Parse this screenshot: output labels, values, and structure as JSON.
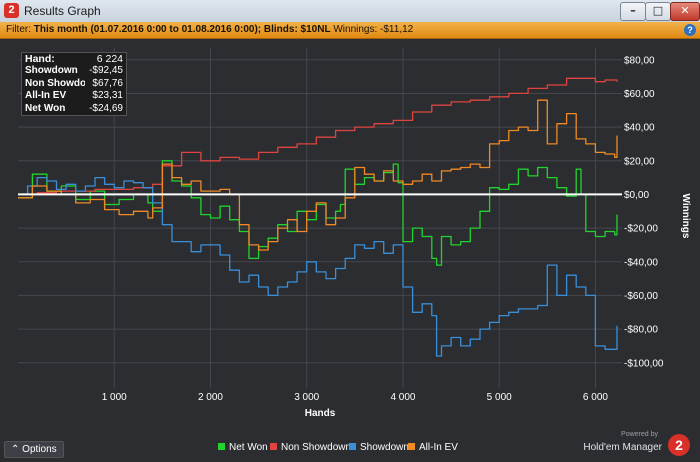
{
  "window": {
    "title": "Results Graph",
    "app_icon": "2",
    "minimize": "–",
    "maximize": "□",
    "close": "✕"
  },
  "filter": {
    "prefix": "Filter: ",
    "period_label": "This month (01.07.2016 0:00 to 01.08.2016 0:00)",
    "blinds_label": "; Blinds: $10NL",
    "winnings_label": " Winnings: -$11,12",
    "help": "?"
  },
  "stats": [
    {
      "label": "Hand:",
      "value": "6 224"
    },
    {
      "label": "Showdown",
      "value": "-$92,45"
    },
    {
      "label": "Non Showdown",
      "value": "$67,76"
    },
    {
      "label": "All-In EV",
      "value": "$23,31"
    },
    {
      "label": "Net Won",
      "value": "-$24,69"
    }
  ],
  "footer": {
    "options_label": "Options",
    "powered_by": "Powered by",
    "brand_name": "Hold'em Manager",
    "brand_logo": "2"
  },
  "colors": {
    "net_won": "#22d32e",
    "non_showdown": "#e0443e",
    "showdown": "#3a8fd9",
    "all_in_ev": "#f08a24"
  },
  "chart_data": {
    "type": "line",
    "xlabel": "Hands",
    "ylabel": "Winnings",
    "xlim": [
      0,
      6224
    ],
    "ylim": [
      -115,
      87
    ],
    "x_ticks": [
      1000,
      2000,
      3000,
      4000,
      5000,
      6000
    ],
    "x_tick_labels": [
      "1 000",
      "2 000",
      "3 000",
      "4 000",
      "5 000",
      "6 000"
    ],
    "y_ticks": [
      80,
      60,
      40,
      20,
      0,
      -20,
      -40,
      -60,
      -80,
      -100
    ],
    "y_tick_labels": [
      "$80,00",
      "$60,00",
      "$40,00",
      "$20,00",
      "$0,00",
      "-$20,00",
      "-$40,00",
      "-$60,00",
      "-$80,00",
      "-$100,00"
    ],
    "grid": true,
    "legend_position": "bottom",
    "series": [
      {
        "name": "Net Won",
        "color": "#22d32e",
        "x": [
          0,
          150,
          300,
          450,
          600,
          750,
          900,
          1050,
          1200,
          1350,
          1400,
          1500,
          1600,
          1700,
          1800,
          1900,
          2000,
          2100,
          2200,
          2300,
          2400,
          2500,
          2600,
          2700,
          2800,
          2900,
          3000,
          3100,
          3200,
          3300,
          3350,
          3400,
          3500,
          3600,
          3700,
          3800,
          3900,
          3950,
          4000,
          4100,
          4200,
          4300,
          4350,
          4400,
          4500,
          4600,
          4700,
          4800,
          4900,
          5000,
          5100,
          5200,
          5300,
          5400,
          5500,
          5600,
          5700,
          5800,
          5850,
          5900,
          6000,
          6100,
          6200,
          6224
        ],
        "y": [
          -2,
          12,
          2,
          5,
          -3,
          2,
          -6,
          -3,
          0,
          -5,
          -10,
          20,
          8,
          5,
          -2,
          -12,
          -14,
          -7,
          -15,
          -22,
          -38,
          -31,
          -26,
          -18,
          -22,
          -10,
          -15,
          -6,
          -14,
          -10,
          -6,
          15,
          6,
          10,
          8,
          13,
          18,
          7,
          -28,
          -20,
          -25,
          -38,
          -42,
          -25,
          -30,
          -28,
          -20,
          -10,
          4,
          3,
          6,
          15,
          11,
          16,
          10,
          4,
          -1,
          15,
          0,
          -22,
          -25,
          -22,
          -24,
          -12
        ]
      },
      {
        "name": "Non Showdown",
        "color": "#e0443e",
        "x": [
          0,
          200,
          400,
          600,
          800,
          1000,
          1200,
          1400,
          1500,
          1700,
          1900,
          2100,
          2300,
          2500,
          2700,
          2900,
          3100,
          3300,
          3500,
          3700,
          3900,
          4100,
          4300,
          4500,
          4700,
          4900,
          5100,
          5300,
          5500,
          5700,
          5800,
          5900,
          6000,
          6100,
          6224
        ],
        "y": [
          0,
          1,
          2,
          2,
          3,
          3,
          4,
          6,
          17,
          25,
          20,
          22,
          21,
          25,
          28,
          30,
          34,
          38,
          40,
          42,
          44,
          49,
          53,
          55,
          56,
          58,
          60,
          63,
          65,
          69,
          69,
          69,
          67,
          68,
          67
        ]
      },
      {
        "name": "Showdown",
        "color": "#3a8fd9",
        "x": [
          0,
          100,
          200,
          300,
          400,
          500,
          600,
          700,
          800,
          900,
          1000,
          1100,
          1200,
          1300,
          1400,
          1500,
          1600,
          1800,
          1900,
          2100,
          2200,
          2300,
          2400,
          2500,
          2600,
          2700,
          2800,
          2900,
          3000,
          3100,
          3200,
          3300,
          3400,
          3500,
          3600,
          3700,
          3800,
          3900,
          4000,
          4100,
          4200,
          4300,
          4350,
          4400,
          4500,
          4600,
          4700,
          4800,
          4900,
          5000,
          5100,
          5200,
          5300,
          5400,
          5500,
          5600,
          5700,
          5800,
          5900,
          6000,
          6100,
          6224
        ],
        "y": [
          0,
          5,
          10,
          8,
          3,
          6,
          2,
          5,
          10,
          6,
          4,
          8,
          7,
          4,
          -5,
          -18,
          -28,
          -34,
          -30,
          -36,
          -45,
          -52,
          -48,
          -55,
          -60,
          -55,
          -52,
          -46,
          -40,
          -46,
          -50,
          -44,
          -38,
          -30,
          -32,
          -28,
          -35,
          -30,
          -55,
          -70,
          -65,
          -72,
          -96,
          -90,
          -85,
          -90,
          -86,
          -80,
          -76,
          -72,
          -70,
          -68,
          -68,
          -66,
          -42,
          -60,
          -48,
          -55,
          -60,
          -90,
          -92,
          -78
        ]
      },
      {
        "name": "All-In EV",
        "color": "#f08a24",
        "x": [
          0,
          150,
          300,
          450,
          600,
          750,
          900,
          1050,
          1200,
          1350,
          1400,
          1500,
          1600,
          1700,
          1800,
          1900,
          2000,
          2100,
          2200,
          2300,
          2400,
          2500,
          2600,
          2700,
          2800,
          2900,
          3000,
          3100,
          3200,
          3300,
          3400,
          3500,
          3600,
          3700,
          3800,
          3900,
          4000,
          4100,
          4200,
          4300,
          4400,
          4500,
          4600,
          4700,
          4800,
          4900,
          5000,
          5100,
          5200,
          5300,
          5400,
          5500,
          5600,
          5700,
          5800,
          5900,
          6000,
          6100,
          6200,
          6224
        ],
        "y": [
          -2,
          5,
          2,
          0,
          -5,
          -3,
          -9,
          -12,
          -10,
          -14,
          -8,
          18,
          10,
          6,
          8,
          2,
          2,
          3,
          0,
          -18,
          -30,
          -33,
          -28,
          -20,
          -15,
          -22,
          -10,
          -5,
          -18,
          -14,
          -2,
          16,
          12,
          8,
          14,
          8,
          6,
          8,
          12,
          8,
          14,
          15,
          16,
          18,
          16,
          30,
          32,
          38,
          40,
          38,
          56,
          30,
          42,
          48,
          33,
          30,
          25,
          24,
          22,
          35
        ]
      }
    ]
  }
}
